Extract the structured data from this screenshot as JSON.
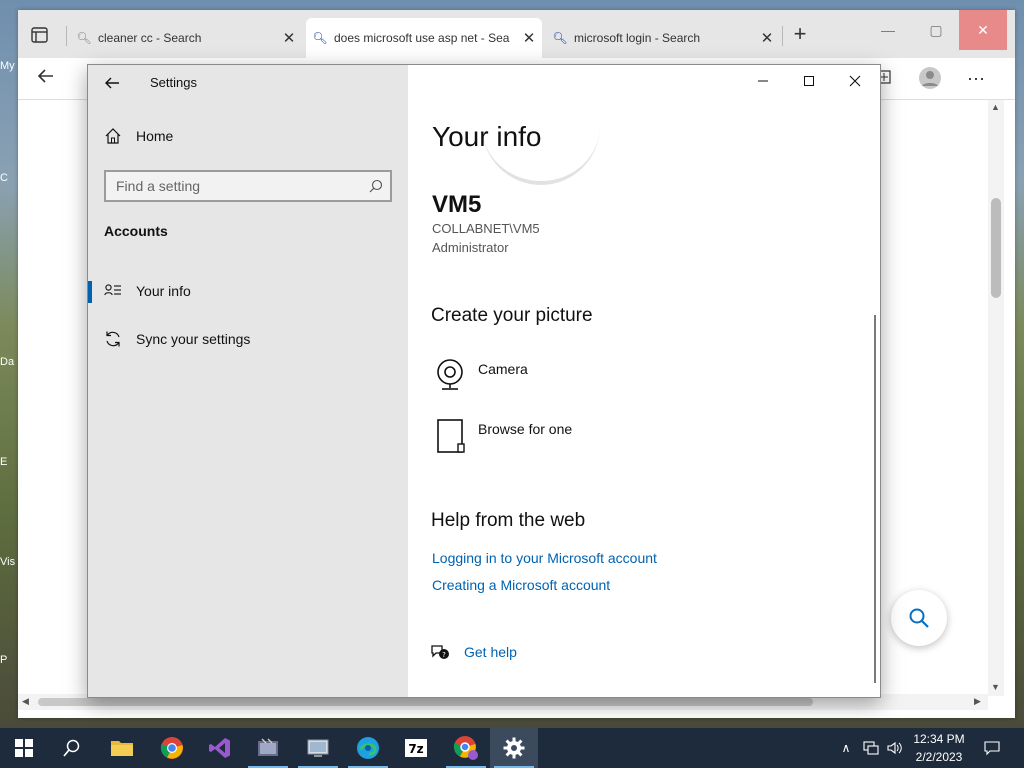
{
  "browser": {
    "tabs": [
      {
        "title": "cleaner cc - Search",
        "icon": "search-icon",
        "active": false
      },
      {
        "title": "does microsoft use asp net - Sea",
        "icon": "search-icon",
        "active": true
      },
      {
        "title": "microsoft login - Search",
        "icon": "search-icon",
        "active": false
      }
    ]
  },
  "desktop": {
    "labels": [
      "My",
      "C",
      "Da",
      "E",
      "Vis",
      "P"
    ]
  },
  "settings": {
    "window_title": "Settings",
    "home_label": "Home",
    "search_placeholder": "Find a setting",
    "section_title": "Accounts",
    "nav": [
      {
        "label": "Your info",
        "icon": "person-list-icon",
        "selected": true
      },
      {
        "label": "Sync your settings",
        "icon": "sync-icon",
        "selected": false
      }
    ],
    "page_title": "Your info",
    "user": {
      "name": "VM5",
      "domain": "COLLABNET\\VM5",
      "role": "Administrator"
    },
    "create_picture": {
      "heading": "Create your picture",
      "options": [
        {
          "label": "Camera",
          "icon": "camera-icon"
        },
        {
          "label": "Browse for one",
          "icon": "browse-file-icon"
        }
      ]
    },
    "help": {
      "heading": "Help from the web",
      "links": [
        "Logging in to your Microsoft account",
        "Creating a Microsoft account"
      ],
      "get_help": "Get help"
    }
  },
  "taskbar": {
    "apps": [
      {
        "name": "file-explorer-icon"
      },
      {
        "name": "chrome-icon"
      },
      {
        "name": "visual-studio-icon"
      },
      {
        "name": "video-editor-icon"
      },
      {
        "name": "network-app-icon"
      },
      {
        "name": "edge-icon"
      },
      {
        "name": "7zip-icon"
      },
      {
        "name": "chrome-profile-icon"
      },
      {
        "name": "settings-gear-icon"
      }
    ],
    "clock": {
      "time": "12:34 PM",
      "date": "2/2/2023"
    }
  },
  "colors": {
    "accent": "#0063b1",
    "taskbar": "#1e2b3c",
    "settings_sidebar": "#e6e6e6",
    "close_hover": "#e88a8a"
  }
}
